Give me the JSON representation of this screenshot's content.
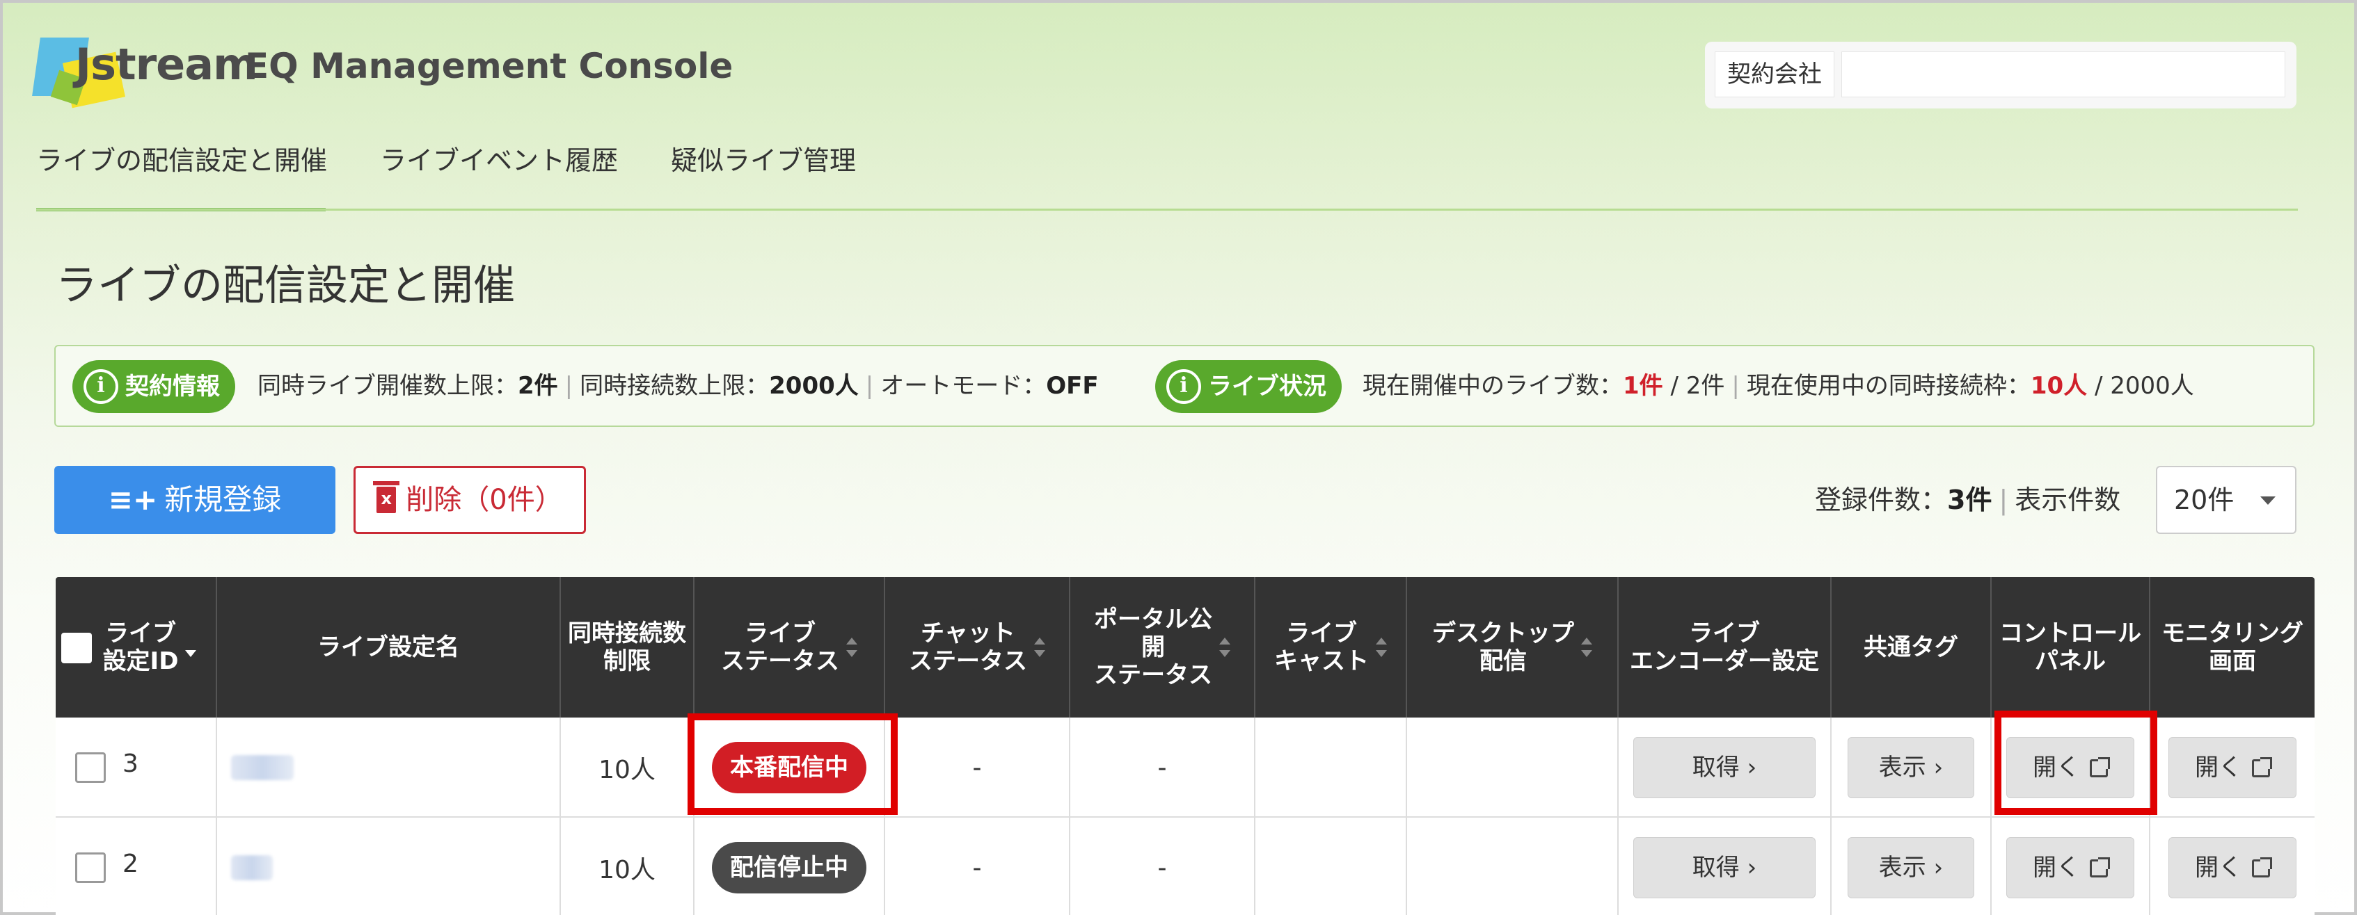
{
  "header": {
    "logo_text": "Jstream",
    "app_title": "EQ Management Console",
    "company_label": "契約会社",
    "company_value": ""
  },
  "nav": {
    "items": [
      {
        "label": "ライブの配信設定と開催",
        "active": true
      },
      {
        "label": "ライブイベント履歴",
        "active": false
      },
      {
        "label": "疑似ライブ管理",
        "active": false
      }
    ]
  },
  "page": {
    "title": "ライブの配信設定と開催"
  },
  "contract_info": {
    "badge": "契約情報",
    "max_live_label": "同時ライブ開催数上限：",
    "max_live_value": "2件",
    "max_conn_label": "同時接続数上限：",
    "max_conn_value": "2000人",
    "auto_mode_label": "オートモード：",
    "auto_mode_value": "OFF"
  },
  "live_status": {
    "badge": "ライブ状況",
    "current_live_label": "現在開催中のライブ数：",
    "current_live_value": "1件",
    "current_live_total": " / 2件",
    "current_conn_label": "現在使用中の同時接続枠：",
    "current_conn_value": "10人",
    "current_conn_total": " / 2000人"
  },
  "actions": {
    "new_label": "新規登録",
    "new_icon": "≡+",
    "delete_label": "削除（0件）"
  },
  "counts": {
    "registered_label": "登録件数：",
    "registered_value": "3件",
    "display_label": "表示件数",
    "page_size": "20件"
  },
  "table": {
    "columns": [
      "ライブ\n設定ID",
      "ライブ設定名",
      "同時接続数\n制限",
      "ライブ\nステータス",
      "チャット\nステータス",
      "ポータル公\n開\nステータス",
      "ライブ\nキャスト",
      "デスクトップ\n配信",
      "ライブ\nエンコーダー設定",
      "共通タグ",
      "コントロール\nパネル",
      "モニタリング\n画面"
    ],
    "rows": [
      {
        "id": "3",
        "name": "",
        "limit": "10人",
        "live_status": "本番配信中",
        "chat_status": "-",
        "portal_status": "-",
        "live_cast": "",
        "desktop": "",
        "encoder_btn": "取得 ›",
        "tag_btn": "表示 ›",
        "control_btn": "開く",
        "monitor_btn": "開く"
      },
      {
        "id": "2",
        "name": "",
        "limit": "10人",
        "live_status": "配信停止中",
        "chat_status": "-",
        "portal_status": "-",
        "live_cast": "",
        "desktop": "",
        "encoder_btn": "取得 ›",
        "tag_btn": "表示 ›",
        "control_btn": "開く",
        "monitor_btn": "開く"
      }
    ]
  },
  "colors": {
    "accent_green": "#59a92c",
    "primary_blue": "#3a8eea",
    "danger_red": "#d21e25",
    "header_dark": "#333333",
    "highlight": "#e00000"
  }
}
